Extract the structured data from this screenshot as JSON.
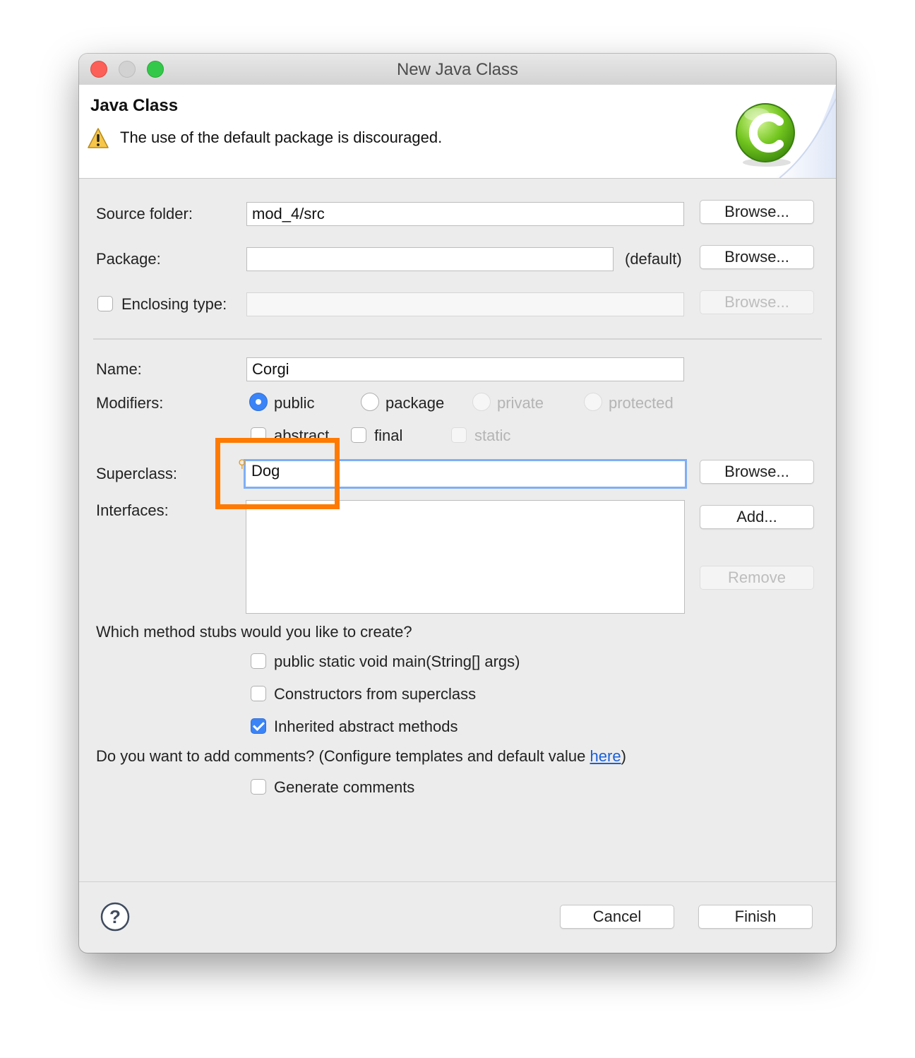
{
  "window": {
    "title": "New Java Class"
  },
  "header": {
    "title": "Java Class",
    "message": "The use of the default package is discouraged.",
    "warning_icon": "warning-triangle-icon",
    "wizard_icon": "java-class-c-icon"
  },
  "form": {
    "source_folder": {
      "label": "Source folder:",
      "value": "mod_4/src",
      "browse": "Browse..."
    },
    "package": {
      "label": "Package:",
      "value": "",
      "suffix": "(default)",
      "browse": "Browse..."
    },
    "enclosing_type": {
      "label": "Enclosing type:",
      "checked": false,
      "value": "",
      "browse": "Browse..."
    },
    "name": {
      "label": "Name:",
      "value": "Corgi"
    },
    "modifiers": {
      "label": "Modifiers:",
      "visibility": [
        {
          "label": "public",
          "selected": true,
          "enabled": true
        },
        {
          "label": "package",
          "selected": false,
          "enabled": true
        },
        {
          "label": "private",
          "selected": false,
          "enabled": false
        },
        {
          "label": "protected",
          "selected": false,
          "enabled": false
        }
      ],
      "flags": [
        {
          "label": "abstract",
          "checked": false,
          "enabled": true
        },
        {
          "label": "final",
          "checked": false,
          "enabled": true
        },
        {
          "label": "static",
          "checked": false,
          "enabled": false
        }
      ]
    },
    "superclass": {
      "label": "Superclass:",
      "value": "Dog",
      "browse": "Browse..."
    },
    "interfaces": {
      "label": "Interfaces:",
      "add": "Add...",
      "remove": "Remove",
      "items": []
    }
  },
  "stubs": {
    "question": "Which method stubs would you like to create?",
    "options": [
      {
        "label": "public static void main(String[] args)",
        "checked": false
      },
      {
        "label": "Constructors from superclass",
        "checked": false
      },
      {
        "label": "Inherited abstract methods",
        "checked": true
      }
    ]
  },
  "comments": {
    "question_prefix": "Do you want to add comments? (Configure templates and default value ",
    "link": "here",
    "question_suffix": ")",
    "generate_label": "Generate comments",
    "generate_checked": false
  },
  "footer": {
    "cancel": "Cancel",
    "finish": "Finish",
    "help_icon": "help-question-icon"
  },
  "colors": {
    "accent": "#3b84f7",
    "highlight": "#ff7a00",
    "focus": "#80aef5",
    "link": "#1a5fd6"
  }
}
